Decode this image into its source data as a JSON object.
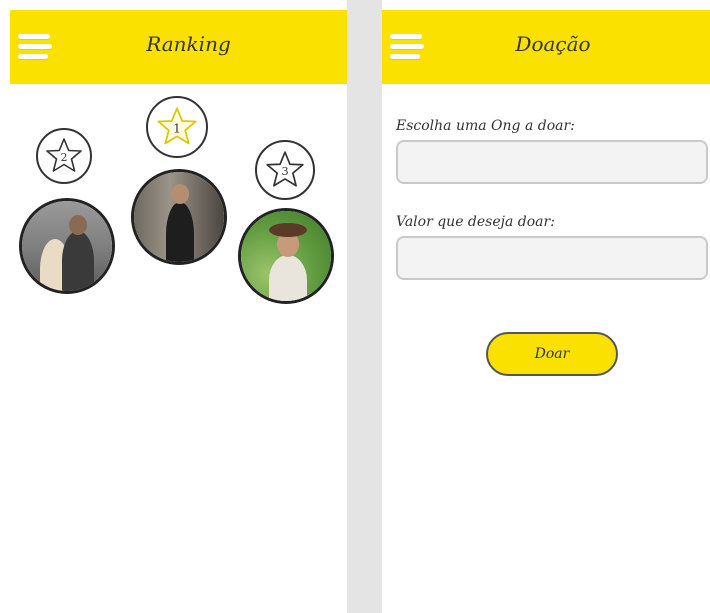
{
  "ranking_screen": {
    "title": "Ranking",
    "ranks": [
      {
        "position": "1"
      },
      {
        "position": "2"
      },
      {
        "position": "3"
      }
    ]
  },
  "doacao_screen": {
    "title": "Doação",
    "ong_label": "Escolha uma Ong a doar:",
    "ong_value": "",
    "valor_label": "Valor que deseja doar:",
    "valor_value": "",
    "button_label": "Doar"
  },
  "colors": {
    "topbar": "#fbe100",
    "divider": "#e4e4e4",
    "field_bg": "#f3f3f3",
    "button_bg": "#fbe100"
  }
}
